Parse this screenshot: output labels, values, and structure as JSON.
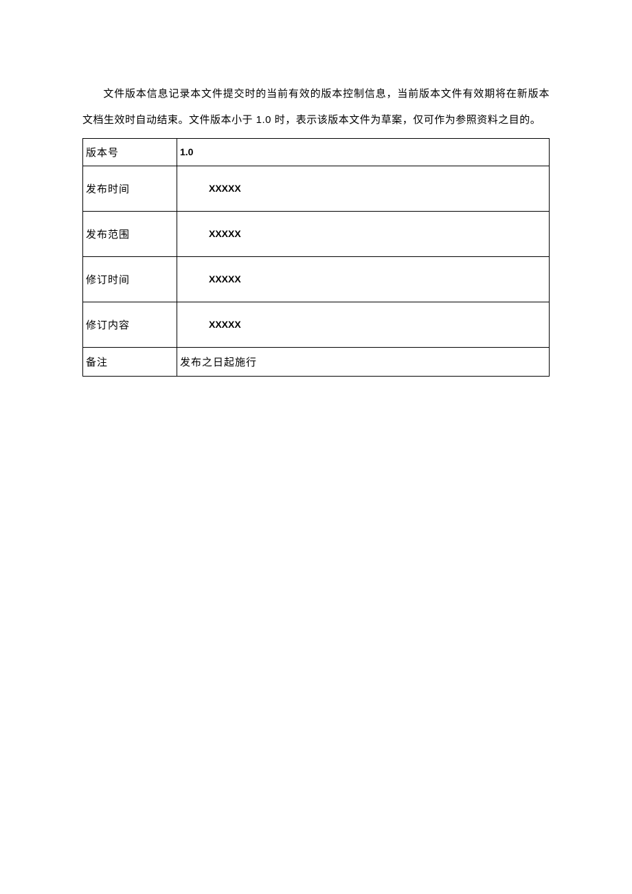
{
  "paragraph": "文件版本信息记录本文件提交时的当前有效的版本控制信息，当前版本文件有效期将在新版本文档生效时自动结束。文件版本小于 1.0 时，表示该版本文件为草案，仅可作为参照资料之目的。",
  "table": {
    "rows": [
      {
        "label": "版本号",
        "value": "1.0",
        "style": "first"
      },
      {
        "label": "发布时间",
        "value": "XXXXX",
        "style": "bold"
      },
      {
        "label": "发布范围",
        "value": "XXXXX",
        "style": "bold"
      },
      {
        "label": "修订时间",
        "value": "XXXXX",
        "style": "bold"
      },
      {
        "label": "修订内容",
        "value": "XXXXX",
        "style": "bold"
      },
      {
        "label": "备注",
        "value": "发布之日起施行",
        "style": "last"
      }
    ]
  }
}
